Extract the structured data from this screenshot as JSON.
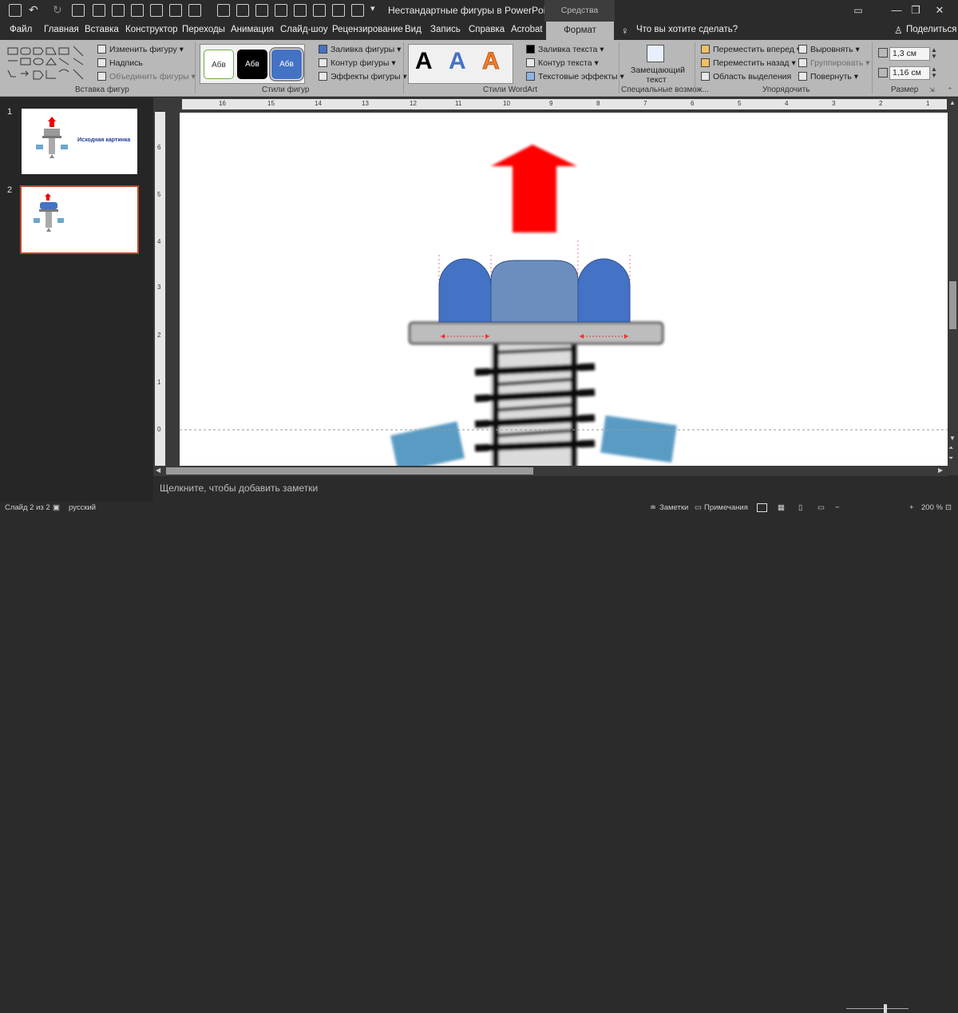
{
  "window": {
    "title": "Нестандартные фигуры в PowerPoint.pptx...",
    "context_band": "Средства рисования",
    "help_glyph": "?",
    "min_glyph": "—",
    "max_glyph": "❐",
    "close_glyph": "✕"
  },
  "tabs": [
    "Файл",
    "Главная",
    "Вставка",
    "Конструктор",
    "Переходы",
    "Анимация",
    "Слайд-шоу",
    "Рецензирование",
    "Вид",
    "Запись",
    "Справка",
    "Acrobat"
  ],
  "active_tab": "Формат",
  "tell_me": "Что вы хотите сделать?",
  "share": "Поделиться",
  "ribbon": {
    "insert_shapes": {
      "label": "Вставка фигур",
      "edit_shape": "Изменить фигуру",
      "textbox": "Надпись",
      "merge": "Объединить фигуры"
    },
    "shape_styles": {
      "label": "Стили фигур",
      "preview": [
        "Абв",
        "Абв",
        "Абв"
      ],
      "fill": "Заливка фигуры",
      "outline": "Контур фигуры",
      "effects": "Эффекты фигуры"
    },
    "wordart": {
      "label": "Стили WordArt",
      "preview": [
        "A",
        "A",
        "A"
      ],
      "text_fill": "Заливка текста",
      "text_outline": "Контур текста",
      "text_effects": "Текстовые эффекты"
    },
    "accessibility": {
      "label": "Специальные возмож...",
      "alt_text": "Замещающий текст"
    },
    "arrange": {
      "label": "Упорядочить",
      "forward": "Переместить вперед",
      "backward": "Переместить назад",
      "selection": "Область выделения",
      "align": "Выровнять",
      "group": "Группировать",
      "rotate": "Повернуть"
    },
    "size": {
      "label": "Размер",
      "height": "1,3 см",
      "width": "1,16 см"
    }
  },
  "slides": [
    {
      "number": "1",
      "caption": "Исходная картинка"
    },
    {
      "number": "2"
    }
  ],
  "hruler_labels": [
    "16",
    "15",
    "14",
    "13",
    "12",
    "11",
    "10",
    "9",
    "8",
    "7",
    "6",
    "5",
    "4",
    "3",
    "2",
    "1"
  ],
  "vruler_labels": [
    "6",
    "5",
    "4",
    "3",
    "2",
    "1",
    "0"
  ],
  "notes_placeholder": "Щелкните, чтобы добавить заметки",
  "status": {
    "slide": "Слайд 2 из 2",
    "language": "русский",
    "notes": "Заметки",
    "comments": "Примечания",
    "zoom": "200 %"
  },
  "colors": {
    "accent": "#b7472a",
    "ribbon": "#b8b8b8",
    "dark": "#2b2b2b",
    "shape_blue": "#4472c4",
    "arrow_red": "#ff0000"
  }
}
